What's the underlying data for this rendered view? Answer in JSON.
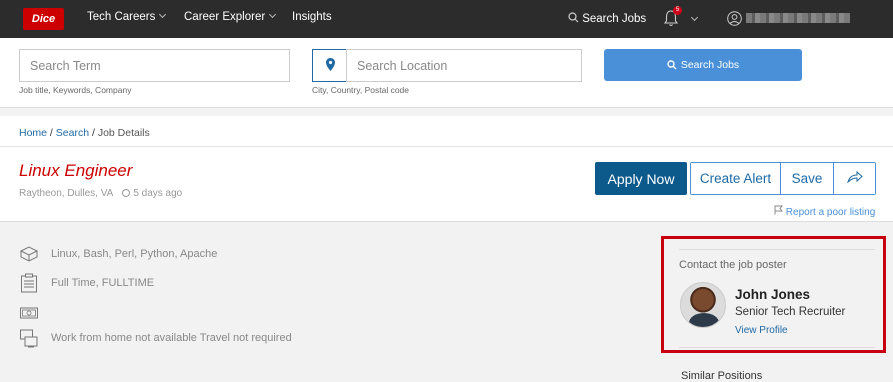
{
  "nav": {
    "logo": "Dice",
    "items": [
      "Tech Careers",
      "Career Explorer",
      "Insights"
    ],
    "search_jobs": "Search Jobs",
    "notification_count": "5"
  },
  "search": {
    "term_placeholder": "Search Term",
    "term_hint": "Job title, Keywords, Company",
    "location_placeholder": "Search Location",
    "location_hint": "City, Country, Postal code",
    "button_label": "Search Jobs"
  },
  "breadcrumb": {
    "home": "Home",
    "search": "Search",
    "current": "Job Details"
  },
  "job": {
    "title": "Linux Engineer",
    "company_location": "Raytheon, Dulles, VA",
    "posted": "5 days ago",
    "apply_label": "Apply Now",
    "create_alert_label": "Create Alert",
    "save_label": "Save",
    "report_label": "Report a poor listing",
    "skills": "Linux, Bash, Perl, Python, Apache",
    "employment_type": "Full Time, FULLTIME",
    "salary": "",
    "remote": "Work from home not available Travel not required"
  },
  "contact": {
    "label": "Contact the job poster",
    "name": "John Jones",
    "title": "Senior Tech Recruiter",
    "profile_link": "View Profile"
  },
  "similar": {
    "heading": "Similar Positions"
  },
  "colors": {
    "nav_bg": "#2c2c2c",
    "brand_red": "#cc0000",
    "primary_blue": "#0c5a8c",
    "link_blue": "#1f6aa5",
    "search_button": "#4a90d9",
    "highlight_border": "#c80010"
  }
}
